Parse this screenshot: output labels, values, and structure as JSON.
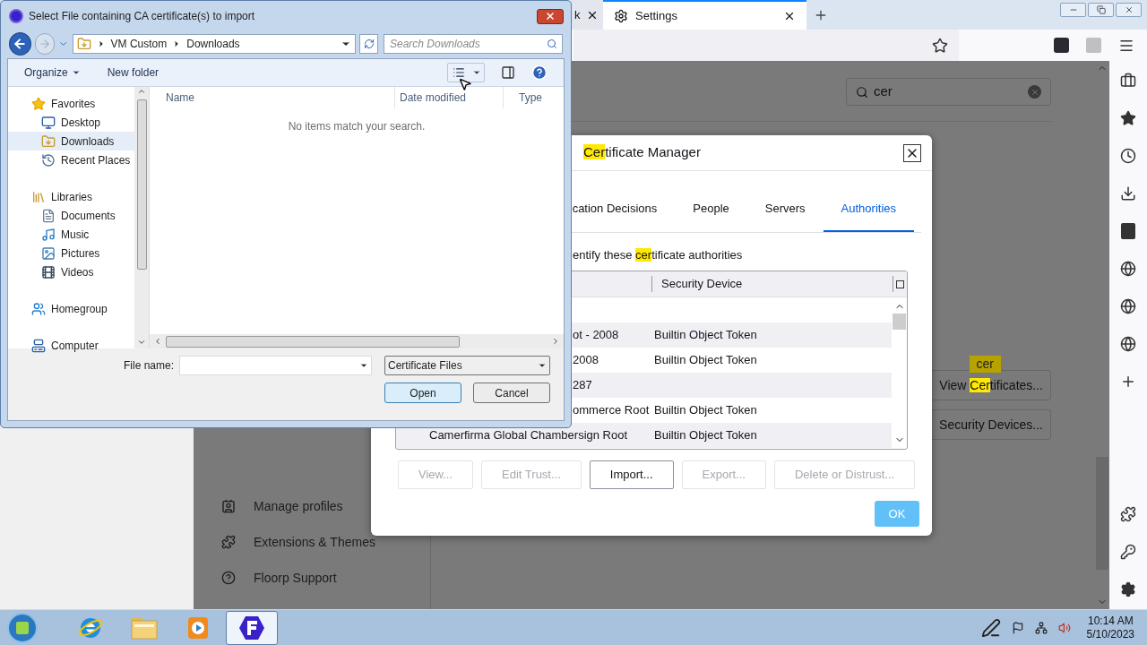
{
  "browser": {
    "tabs": [
      {
        "label": "k",
        "selected": false
      },
      {
        "label": "Settings",
        "selected": true
      }
    ],
    "search": {
      "value": "cer"
    },
    "nav": [
      {
        "label": "Manage profiles",
        "kind": "profiles"
      },
      {
        "label": "Extensions & Themes",
        "kind": "extensions"
      },
      {
        "label": "Floorp Support",
        "kind": "help"
      }
    ],
    "buttons": [
      {
        "parts": [
          {
            "text": "View ",
            "highlighted": false
          },
          {
            "text": "Cer",
            "highlighted": true
          },
          {
            "text": "tificates...",
            "highlighted": false
          }
        ]
      },
      {
        "parts": [
          {
            "text": "Security Devices...",
            "highlighted": false
          }
        ]
      }
    ],
    "tooltip": "cer"
  },
  "cert_manager": {
    "title": [
      {
        "text": "Cer",
        "highlighted": true
      },
      {
        "text": "tificate Manager",
        "highlighted": false
      }
    ],
    "tabs": [
      {
        "label": "cation Decisions",
        "selected": false
      },
      {
        "label": "People",
        "selected": false
      },
      {
        "label": "Servers",
        "selected": false
      },
      {
        "label": "Authorities",
        "selected": true
      }
    ],
    "intro": [
      {
        "text": "entify these ",
        "highlighted": false
      },
      {
        "text": "cer",
        "highlighted": true
      },
      {
        "text": "tificate authorities",
        "highlighted": false
      }
    ],
    "columns": [
      "Security Device"
    ],
    "rows": [
      {},
      {
        "name": "ot - 2008",
        "device": "Builtin Object Token",
        "cut_off_left": true
      },
      {
        "name": "2008",
        "device": "Builtin Object Token",
        "cut_off_left": true
      },
      {
        "name": "287",
        "cut_off_left": true
      },
      {
        "name": "ommerce Root",
        "device": "Builtin Object Token",
        "cut_off_left": true
      },
      {
        "name": "Camerfirma Global Chambersign Root",
        "device": "Builtin Object Token",
        "cut_off_left": false
      }
    ],
    "buttons": [
      {
        "label": "View...",
        "disabled": true
      },
      {
        "label": "Edit Trust...",
        "disabled": true
      },
      {
        "label": "Import...",
        "disabled": false
      },
      {
        "label": "Export...",
        "disabled": true
      },
      {
        "label": "Delete or Distrust...",
        "disabled": true
      }
    ],
    "ok": "OK"
  },
  "file_dialog": {
    "title": "Select File containing CA certificate(s) to import",
    "path": [
      "VM Custom",
      "Downloads"
    ],
    "search": {
      "placeholder": "Search Downloads"
    },
    "toolbar": [
      "Organize",
      "New folder"
    ],
    "nav": [
      {
        "label": "Favorites",
        "kind": "star",
        "selected": false,
        "children": [
          {
            "label": "Desktop",
            "kind": "desktop",
            "selected": false
          },
          {
            "label": "Downloads",
            "kind": "downloads",
            "selected": true
          },
          {
            "label": "Recent Places",
            "kind": "recent",
            "selected": false
          }
        ]
      },
      {
        "label": "Libraries",
        "kind": "library",
        "selected": false,
        "children": [
          {
            "label": "Documents",
            "kind": "documents",
            "selected": false
          },
          {
            "label": "Music",
            "kind": "music",
            "selected": false
          },
          {
            "label": "Pictures",
            "kind": "pictures",
            "selected": false
          },
          {
            "label": "Videos",
            "kind": "videos",
            "selected": false
          }
        ]
      },
      {
        "label": "Homegroup",
        "kind": "homegroup",
        "selected": false
      },
      {
        "label": "Computer",
        "kind": "computer",
        "selected": false
      }
    ],
    "columns": [
      "Name",
      "Date modified",
      "Type"
    ],
    "empty_message": "No items match your search.",
    "file_name_label": "File name:",
    "file_type": "Certificate Files",
    "buttons": [
      "Open",
      "Cancel"
    ]
  },
  "taskbar": {
    "apps": [
      {
        "kind": "ie",
        "selected": false
      },
      {
        "kind": "explorer",
        "selected": false
      },
      {
        "kind": "media",
        "selected": false
      },
      {
        "kind": "floorp",
        "selected": true
      }
    ],
    "time": "10:14 AM",
    "date": "5/10/2023"
  }
}
